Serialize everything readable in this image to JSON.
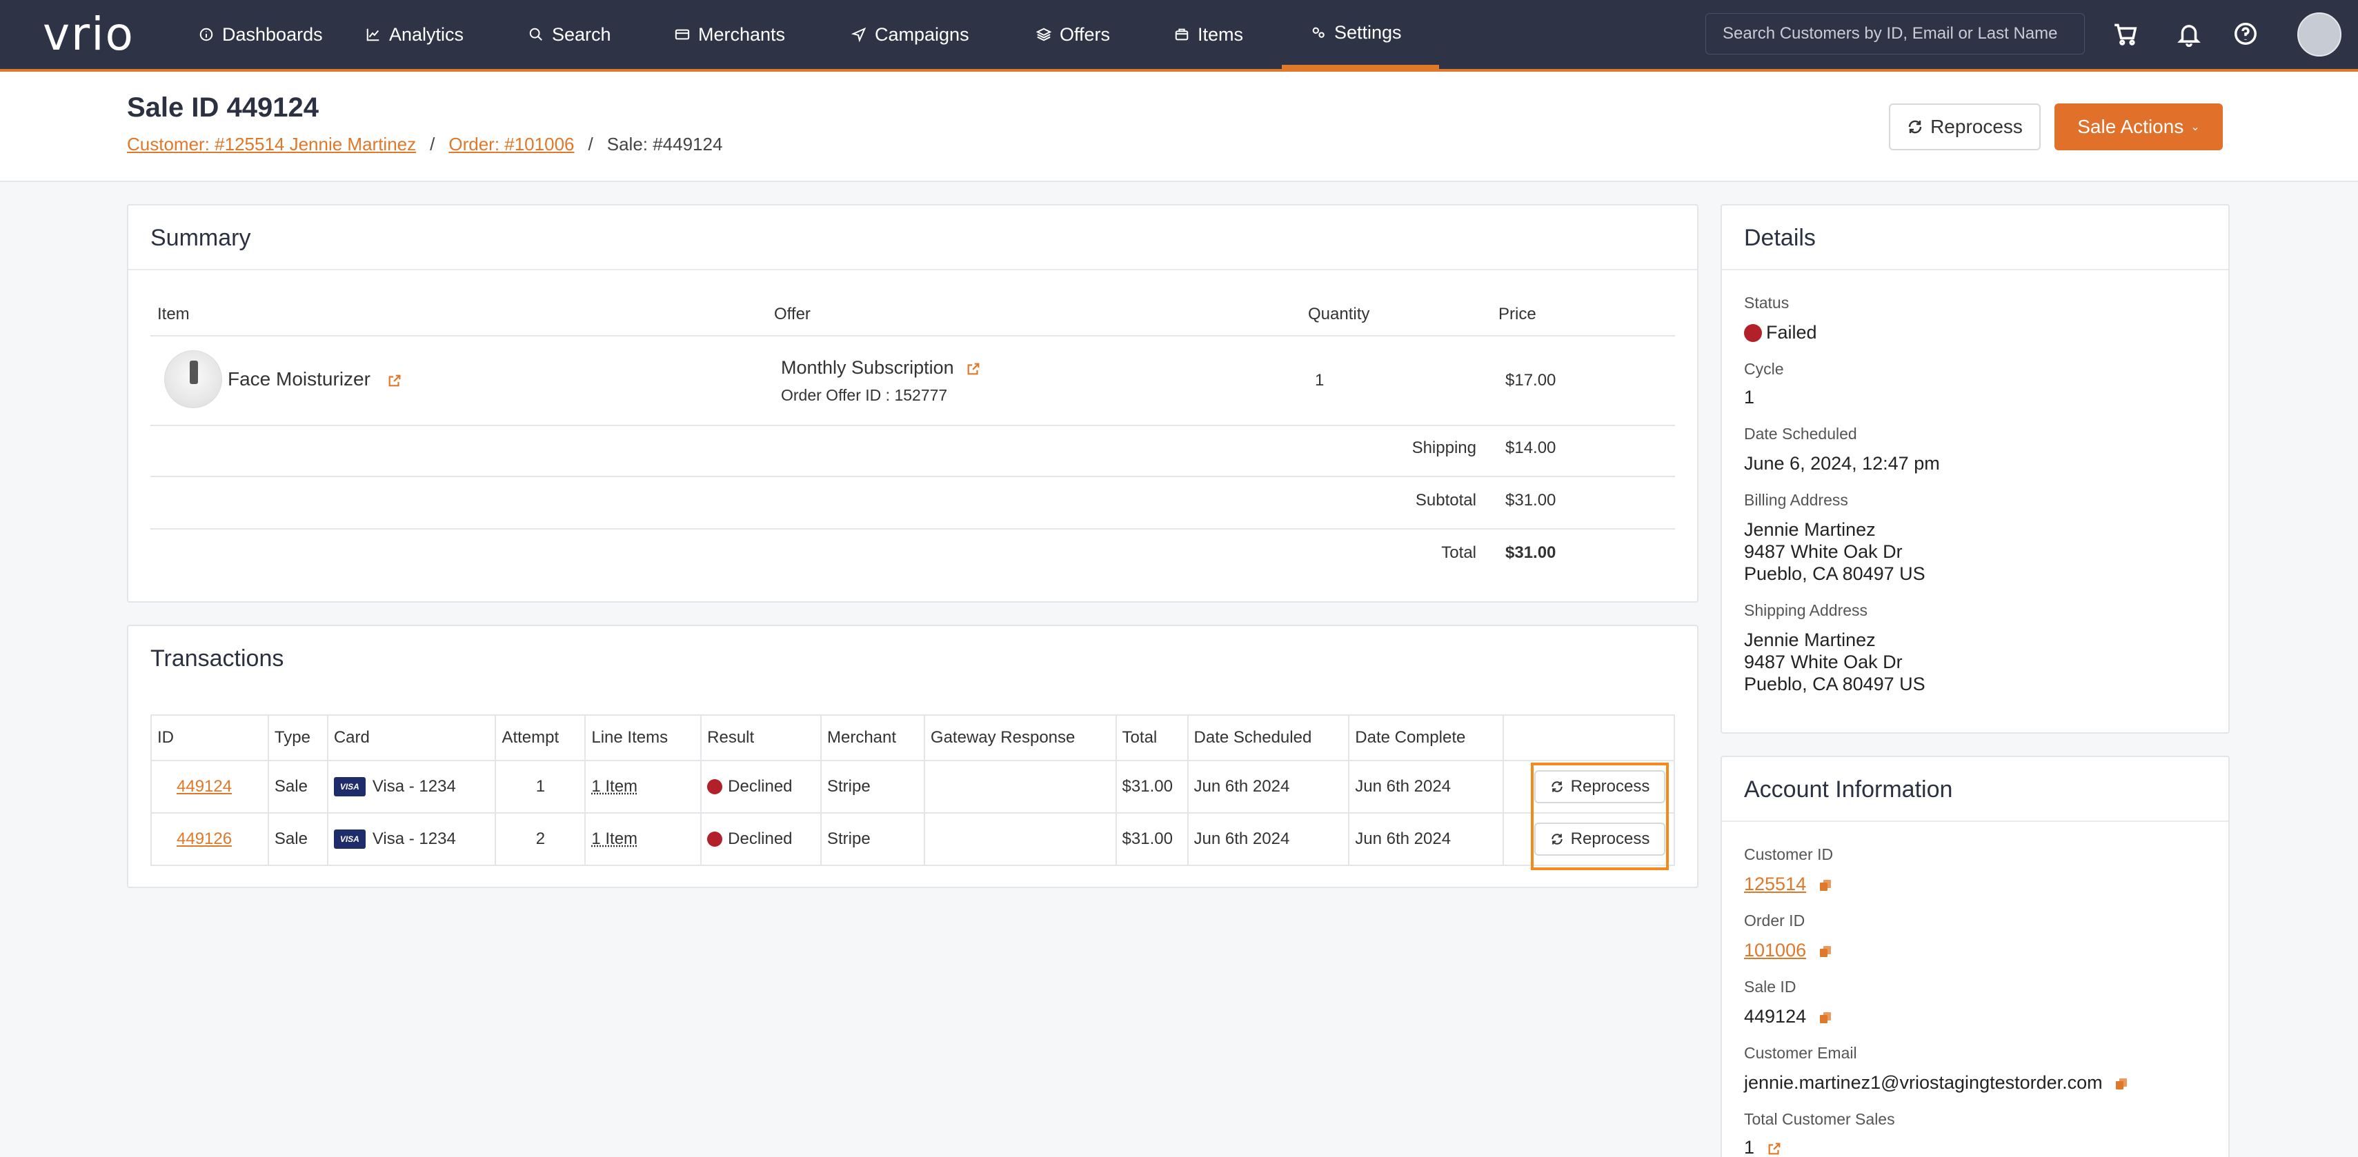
{
  "nav": {
    "logo": "vrio",
    "items": [
      {
        "label": "Dashboards",
        "icon": "info-circle-icon"
      },
      {
        "label": "Analytics",
        "icon": "line-chart-icon"
      },
      {
        "label": "Search",
        "icon": "search-icon"
      },
      {
        "label": "Merchants",
        "icon": "credit-card-icon"
      },
      {
        "label": "Campaigns",
        "icon": "send-icon"
      },
      {
        "label": "Offers",
        "icon": "layers-icon"
      },
      {
        "label": "Items",
        "icon": "box-icon"
      },
      {
        "label": "Settings",
        "icon": "gears-icon"
      }
    ],
    "active": "Settings",
    "search_placeholder": "Search Customers by ID, Email or Last Name"
  },
  "header": {
    "title": "Sale ID 449124",
    "breadcrumb": {
      "customer": "Customer: #125514 Jennie Martinez",
      "order": "Order: #101006",
      "sale": "Sale: #449124",
      "sep": "/"
    },
    "reprocess_label": "Reprocess",
    "actions_label": "Sale Actions"
  },
  "summary": {
    "title": "Summary",
    "columns": {
      "item": "Item",
      "offer": "Offer",
      "quantity": "Quantity",
      "price": "Price"
    },
    "row": {
      "item": "Face Moisturizer",
      "offer": "Monthly Subscription",
      "offer_id": "Order Offer ID : 152777",
      "quantity": "1",
      "price": "$17.00"
    },
    "shipping_label": "Shipping",
    "shipping": "$14.00",
    "subtotal_label": "Subtotal",
    "subtotal": "$31.00",
    "total_label": "Total",
    "total": "$31.00"
  },
  "transactions": {
    "title": "Transactions",
    "columns": [
      "ID",
      "Type",
      "Card",
      "Attempt",
      "Line Items",
      "Result",
      "Merchant",
      "Gateway Response",
      "Total",
      "Date Scheduled",
      "Date Complete",
      ""
    ],
    "rows": [
      {
        "id": "449124",
        "type": "Sale",
        "card_brand": "VISA",
        "card": "Visa - 1234",
        "attempt": "1",
        "line_items": "1 Item",
        "result": "Declined",
        "merchant": "Stripe",
        "gateway": "",
        "total": "$31.00",
        "scheduled": "Jun 6th 2024",
        "complete": "Jun 6th 2024",
        "action": "Reprocess"
      },
      {
        "id": "449126",
        "type": "Sale",
        "card_brand": "VISA",
        "card": "Visa - 1234",
        "attempt": "2",
        "line_items": "1 Item",
        "result": "Declined",
        "merchant": "Stripe",
        "gateway": "",
        "total": "$31.00",
        "scheduled": "Jun 6th 2024",
        "complete": "Jun 6th 2024",
        "action": "Reprocess"
      }
    ]
  },
  "details": {
    "title": "Details",
    "status_label": "Status",
    "status": "Failed",
    "cycle_label": "Cycle",
    "cycle": "1",
    "scheduled_label": "Date Scheduled",
    "scheduled": "June 6, 2024, 12:47 pm",
    "billing_label": "Billing Address",
    "billing": [
      "Jennie Martinez",
      "9487 White Oak Dr",
      "Pueblo, CA 80497 US"
    ],
    "shipping_label": "Shipping Address",
    "shipping": [
      "Jennie Martinez",
      "9487 White Oak Dr",
      "Pueblo, CA 80497 US"
    ]
  },
  "account": {
    "title": "Account Information",
    "customer_id_label": "Customer ID",
    "customer_id": "125514",
    "order_id_label": "Order ID",
    "order_id": "101006",
    "sale_id_label": "Sale ID",
    "sale_id": "449124",
    "email_label": "Customer Email",
    "email": "jennie.martinez1@vriostagingtestorder.com",
    "total_sales_label": "Total Customer Sales",
    "total_sales": "1"
  },
  "colors": {
    "nav_bg": "#2e3446",
    "accent": "#e0782a",
    "declined": "#b2202a"
  }
}
